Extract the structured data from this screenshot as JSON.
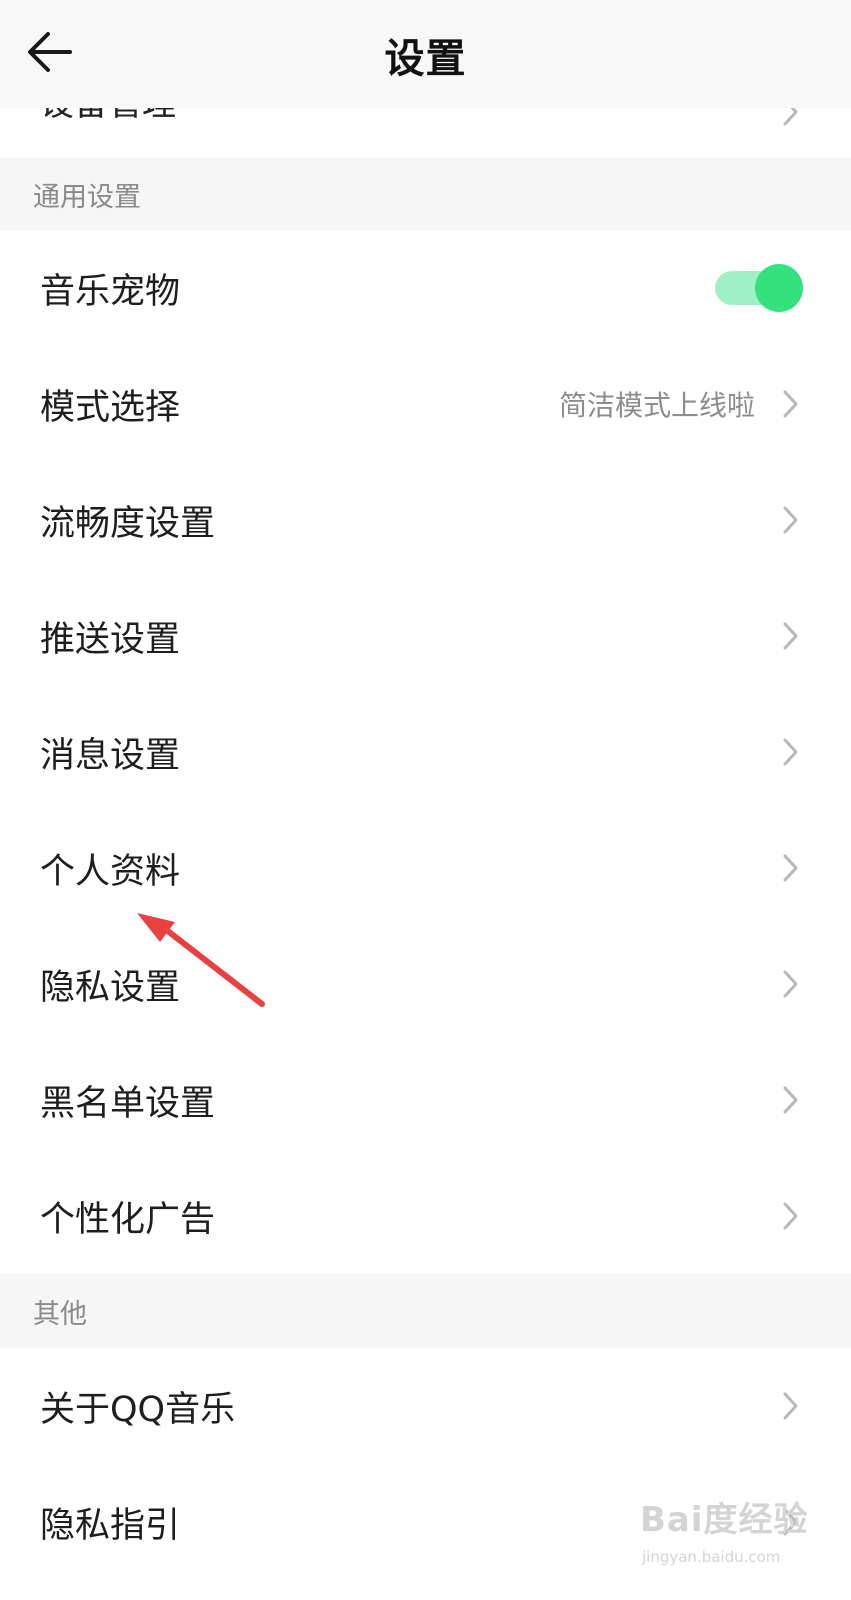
{
  "header": {
    "title": "设置"
  },
  "clipped_row": {
    "label": "设备管理"
  },
  "sections": {
    "general": {
      "title": "通用设置"
    },
    "other": {
      "title": "其他"
    }
  },
  "rows": {
    "music_pet": {
      "label": "音乐宠物",
      "toggle_on": true
    },
    "mode": {
      "label": "模式选择",
      "value": "简洁模式上线啦"
    },
    "smoothness": {
      "label": "流畅度设置"
    },
    "push": {
      "label": "推送设置"
    },
    "message": {
      "label": "消息设置"
    },
    "profile": {
      "label": "个人资料"
    },
    "privacy": {
      "label": "隐私设置"
    },
    "blacklist": {
      "label": "黑名单设置"
    },
    "ads": {
      "label": "个性化广告"
    },
    "about": {
      "label": "关于QQ音乐"
    },
    "privacy_guide": {
      "label": "隐私指引"
    }
  },
  "watermark": {
    "brand": "Bai度经验",
    "url": "jingyan.baidu.com"
  },
  "colors": {
    "accent_green": "#33e27d",
    "toggle_track": "#9ff0c6",
    "annotation_arrow": "#e8413f",
    "section_bg": "#f6f6f6"
  },
  "icons": [
    "back-arrow-icon",
    "chevron-right-icon",
    "annotation-arrow"
  ]
}
